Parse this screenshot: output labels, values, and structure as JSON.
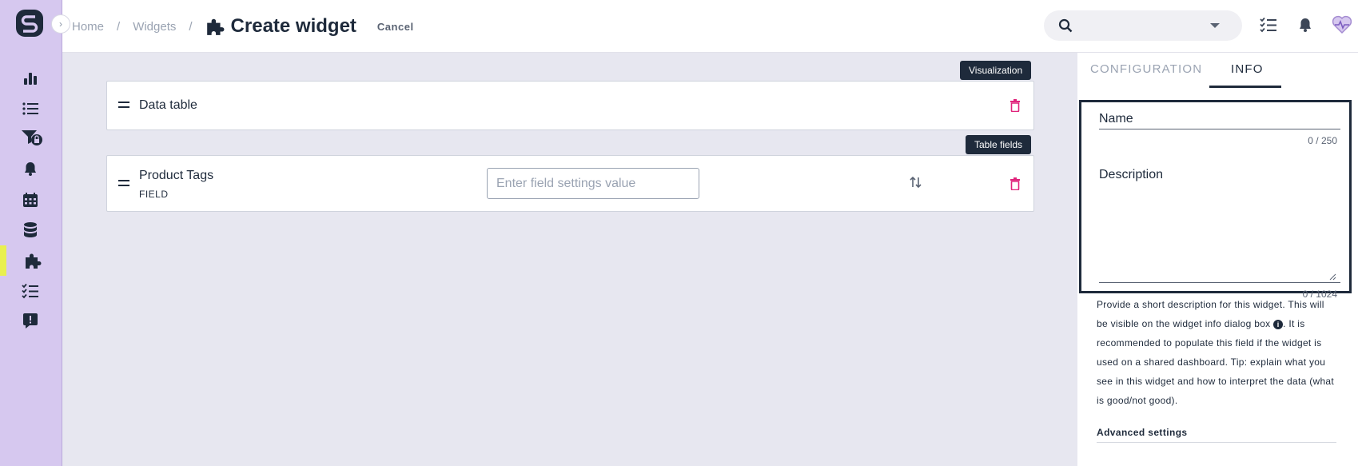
{
  "breadcrumb": {
    "home": "Home",
    "widgets": "Widgets",
    "sep": "/"
  },
  "page": {
    "title": "Create widget",
    "cancel": "Cancel"
  },
  "sections": {
    "visualization_tag": "Visualization",
    "table_fields_tag": "Table fields"
  },
  "visualization": {
    "name": "Data table"
  },
  "table_field": {
    "name": "Product Tags",
    "type": "FIELD",
    "input_placeholder": "Enter field settings value",
    "input_value": ""
  },
  "right_panel": {
    "tabs": [
      "CONFIGURATION",
      "INFO"
    ],
    "active_tab": "INFO",
    "name_label": "Name",
    "name_count": "0 / 250",
    "description_label": "Description",
    "description_count": "0 / 1024",
    "help_before_icon": "Provide a short description for this widget. This will be visible on the widget info dialog box ",
    "help_after_icon": ". It is recommended to populate this field if the widget is used on a shared dashboard. Tip: explain what you see in this widget and how to interpret the data (what is good/not good).",
    "advanced": "Advanced settings"
  },
  "icons": {
    "sidebar": [
      "bar-chart-icon",
      "list-icon",
      "funnel-lock-icon",
      "bell-icon",
      "calendar-icon",
      "database-icon",
      "puzzle-icon",
      "checklist-icon",
      "alert-message-icon"
    ],
    "top": [
      "search-icon",
      "checklist-icon",
      "bell-icon",
      "heart-pulse-icon"
    ]
  },
  "colors": {
    "sidebar": "#d6c8ef",
    "active_marker": "#e9f04f",
    "dark": "#1e2a3b",
    "delete": "#e0237b"
  }
}
